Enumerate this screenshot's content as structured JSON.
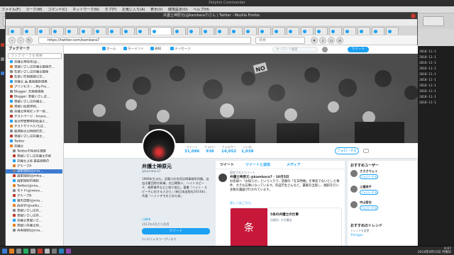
{
  "desktop": {
    "window_title": "Dolphin Commander",
    "menu": [
      "ファイル(F)",
      "マーク(M)",
      "コマンド(C)",
      "ネットワーク(N)",
      "タブ(T)",
      "お気に入り(A)",
      "表示(V)",
      "環境設定(O)",
      "ヘルプ(H)"
    ]
  },
  "firefox": {
    "title": "弁護士神原元(@kambara7)さん | Twitter - Mozilla Firefox",
    "url": "https://twitter.com/kambara7",
    "search_placeholder": "検索"
  },
  "sidebar": {
    "header": "ブックマーク",
    "search_placeholder": "ブックマークを検索",
    "items": [
      {
        "label": "弁護士神原元(@...",
        "selected": false
      },
      {
        "label": "車載いさしば弁護士最後の...",
        "selected": false
      },
      {
        "label": "任意いさしば弁護士最後",
        "selected": false
      },
      {
        "label": "任意い方規格取引文...",
        "selected": false
      },
      {
        "label": "弁護士 品 最高最新規格",
        "selected": false
      },
      {
        "label": "ブリンセス・...My-Fro...",
        "selected": false
      },
      {
        "label": "Blogger: 方規格規格",
        "selected": false
      },
      {
        "label": "Blogger: 車載いさしば...",
        "selected": false
      },
      {
        "label": "車載いさしば弁護士...",
        "selected": false
      },
      {
        "label": "車載い西鉄体制...",
        "selected": false
      },
      {
        "label": "弁護士体制センター前...",
        "selected": false
      },
      {
        "label": "テストページ - hirano...",
        "selected": false
      },
      {
        "label": "金沢市警察体制社会と...",
        "selected": false
      },
      {
        "label": "テストサイト/いちば...",
        "selected": false
      },
      {
        "label": "最適新日日時間の式...",
        "selected": false
      },
      {
        "label": "車載いさしば弁護士...",
        "selected": false
      },
      {
        "label": "Twitter",
        "selected": false
      },
      {
        "label": "弁護士",
        "selected": false
      },
      {
        "label": "Twitterの有用な検索",
        "selected": false
      },
      {
        "label": "車載いさしば弁護士の前",
        "selected": false
      },
      {
        "label": "弁護士上島 最高規格の",
        "selected": false
      },
      {
        "label": "グループA",
        "selected": false
      },
      {
        "label": "国家規制(@nira...",
        "selected": true
      },
      {
        "label": "国家規制(@mika...",
        "selected": false
      },
      {
        "label": "国家規制の規制",
        "selected": false
      },
      {
        "label": "Twitter(@nira...",
        "selected": false
      },
      {
        "label": "モトド(@mtmn...",
        "selected": false
      },
      {
        "label": "グループB",
        "selected": false
      },
      {
        "label": "猪木正樹(@nira...",
        "selected": false
      },
      {
        "label": "西谷学(@saibu...",
        "selected": false
      },
      {
        "label": "車載いさしば弁...",
        "selected": false
      },
      {
        "label": "車載いさしば弁...",
        "selected": false
      },
      {
        "label": "弁護士車載いさ...",
        "selected": false
      },
      {
        "label": "車載い弁護士前...",
        "selected": false
      },
      {
        "label": "再再規制(@nira...",
        "selected": false
      }
    ]
  },
  "twitter": {
    "nav": [
      "ホーム",
      "モーメント",
      "通知",
      "メッセージ"
    ],
    "search_placeholder": "キーワード検索",
    "tweet_button": "ツイート",
    "stats": [
      {
        "label": "ツイート",
        "value": "31,096"
      },
      {
        "label": "フォロー",
        "value": "938"
      },
      {
        "label": "フォロワー",
        "value": "14,052"
      },
      {
        "label": "いいね",
        "value": "1,038"
      }
    ],
    "follow_button": "フォローする",
    "profile": {
      "name": "弁護士神原元",
      "handle": "@kambara7",
      "bio": "1966年生まれ。武蔵小杉合同法律事務所所属。自由法曹団常任幹事。在日朝鮮人、ヘイトスピーチ、冤罪事件などに取り組む。著書『ヘイト・スピーチに抗する人びと』(新日本出版社2014年)、共著『ヘイトデモをとめた街』",
      "location": "川崎市",
      "joined": "2012年4月から利用",
      "tweet_button": "ツイート",
      "followers_you_know": "1人のフォロワーがいます"
    },
    "timeline": {
      "tabs": [
        "ツイート",
        "ツイートと返信",
        "メディア"
      ],
      "pinned": "固定されたツイート",
      "author": "弁護士神原元 @kambara7 · 10月5日",
      "text": "お客様へ「お知らせ」という入りで、話題の「在日特権」を事実でないとした事件、大きな記事になっています。有田芳生さんなど。書籍を出版し、翻訳を行い多数の議論が行われています。",
      "more": "詳しくはこちら",
      "card_img": "条",
      "card_title": "5条の弁護士の仕事",
      "card_desc": "出版社: 大月書店"
    },
    "right": {
      "header": "おすすめユーザー",
      "users": [
        "さささウェイ",
        "上窪涼子",
        "中山哲也"
      ],
      "follow_label": "フォローする",
      "trends_header": "おすすめのトレンド",
      "trends_sub": "トレンドを変更",
      "trend_tag": "#ningyo"
    }
  },
  "terminal": {
    "lines": [
      "2018-11-1",
      "2018-11-1",
      "2018-11-1",
      "2018-11-1",
      "2018-11-1",
      "2018-11-1",
      "2018-11-1",
      "2018-11-1",
      "2018-11-1",
      "2018-11-1"
    ]
  },
  "taskbar": {
    "time": "6:07",
    "date": "2018年9月15日 月曜日"
  }
}
